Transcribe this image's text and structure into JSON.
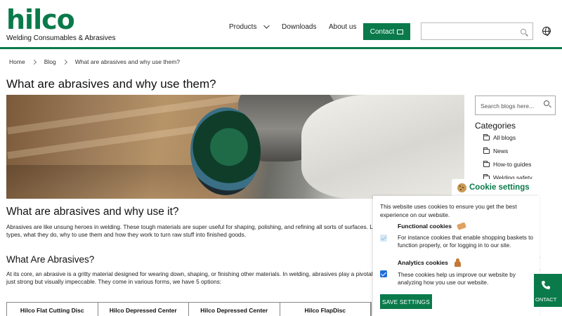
{
  "header": {
    "logo_word": "hilco",
    "logo_tagline": "Welding Consumables & Abrasives",
    "nav": {
      "products": "Products",
      "downloads": "Downloads",
      "about": "About us",
      "contact": "Contact"
    },
    "search_placeholder": ""
  },
  "breadcrumb": [
    "Home",
    "Blog",
    "What are abrasives and why use them?"
  ],
  "article": {
    "title": "What are abrasives and why use them?",
    "h2": "What are abrasives and why use it?",
    "p1": "Abrasives are like unsung heroes in welding. These tough materials are super useful for shaping, polishing, and refining all sorts of surfaces. Let’s d… the different types, what they do, why to use them and how they work to turn raw stuff into finished goods.",
    "h3": "What Are Abrasives?",
    "p2": "At its core, an abrasive is a gritty material designed for wearing down, shaping, or finishing other materials. In welding, abrasives play a pivotal rol… that welds are not just strong but visually impeccable. They come in various forms, we have 5 options:",
    "table_headers": [
      "Hilco Flat Cutting Disc",
      "Hilco Depressed Center",
      "Hilco Depressed Center",
      "Hilco FlapDisc"
    ]
  },
  "sidebar": {
    "search_placeholder": "Search blogs here...",
    "categories_title": "Categories",
    "categories": [
      "All blogs",
      "News",
      "How-to guides",
      "Welding safety"
    ],
    "peek": [
      ")",
      ")"
    ]
  },
  "cookie": {
    "tab_title": "Cookie settings",
    "intro": "This website uses cookies to ensure you get the best experience on our website.",
    "functional_title": "Functional cookies",
    "functional_desc": "For instance cookies that enable shopping baskets to function properly, or for logging in to our site.",
    "analytics_title": "Analytics cookies",
    "analytics_desc": "These cookies help us improve our website by analyzing how you use our website.",
    "save_label": "SAVE SETTINGS"
  },
  "side_contact": {
    "label": "ONTACT"
  },
  "colors": {
    "brand_green": "#0a7a4b",
    "checkbox_blue": "#1e6fd9"
  }
}
